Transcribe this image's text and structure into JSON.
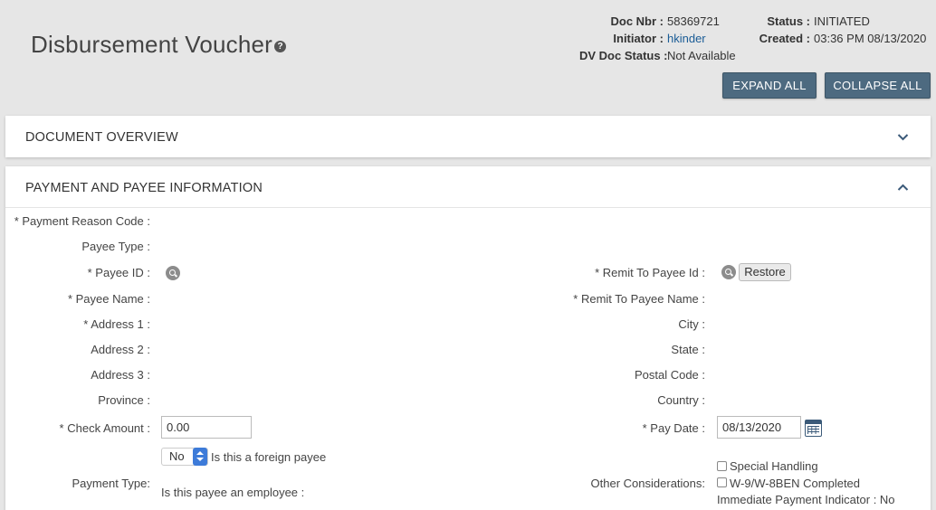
{
  "header": {
    "title": "Disbursement Voucher",
    "help_glyph": "?",
    "doc_nbr_label": "Doc Nbr :",
    "doc_nbr": "58369721",
    "initiator_label": "Initiator :",
    "initiator": "hkinder",
    "dv_doc_status_label": "DV Doc Status :",
    "dv_doc_status": "Not Available",
    "status_label": "Status :",
    "status": "INITIATED",
    "created_label": "Created :",
    "created": "03:36 PM 08/13/2020",
    "expand_all": "EXPAND ALL",
    "collapse_all": "COLLAPSE ALL"
  },
  "sections": {
    "document_overview": "DOCUMENT OVERVIEW",
    "payment_payee": "PAYMENT AND PAYEE INFORMATION"
  },
  "form": {
    "payment_reason_code_label": "* Payment Reason Code :",
    "payee_type_label": "Payee Type :",
    "payee_id_label": "* Payee ID :",
    "payee_name_label": "* Payee Name :",
    "address1_label": "* Address 1 :",
    "address2_label": "Address 2 :",
    "address3_label": "Address 3 :",
    "province_label": "Province :",
    "check_amount_label": "* Check Amount :",
    "check_amount_value": "0.00",
    "foreign_payee_select": "No",
    "foreign_payee_label": "Is this a foreign payee",
    "payment_type_label": "Payment Type:",
    "employee_question": "Is this payee an employee :",
    "remit_to_payee_id_label": "* Remit To Payee Id :",
    "restore_button": "Restore",
    "remit_to_payee_name_label": "* Remit To Payee Name :",
    "city_label": "City :",
    "state_label": "State :",
    "postal_code_label": "Postal Code :",
    "country_label": "Country :",
    "pay_date_label": "* Pay Date :",
    "pay_date_value": "08/13/2020",
    "other_considerations_label": "Other Considerations:",
    "special_handling": "Special Handling",
    "w9_completed": "W-9/W-8BEN Completed",
    "immediate_payment": "Immediate Payment Indicator : No"
  },
  "icons": {
    "help": "help-icon",
    "search": "search-icon",
    "calendar": "calendar-icon",
    "chevron_down": "chevron-down-icon",
    "chevron_up": "chevron-up-icon"
  },
  "colors": {
    "primary_button": "#4d6a80",
    "link": "#1a5c96",
    "select_accent": "#3d7bd9"
  }
}
